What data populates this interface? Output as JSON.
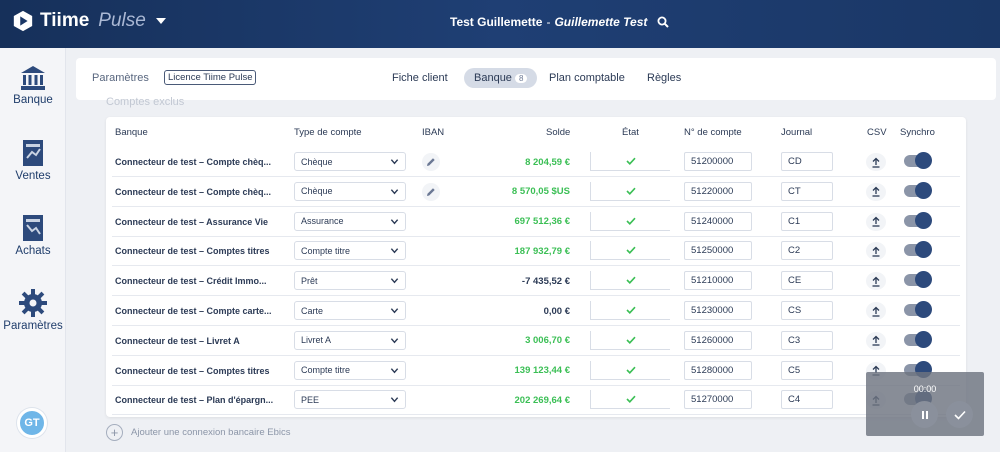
{
  "header": {
    "brand": "Tiime",
    "brand_sub": "Pulse",
    "user_company": "Test Guillemette",
    "user_separator": " - ",
    "user_name": "Guillemette Test"
  },
  "sidebar": {
    "items": [
      {
        "label": "Banque",
        "icon": "bank-icon"
      },
      {
        "label": "Ventes",
        "icon": "sales-document-icon"
      },
      {
        "label": "Achats",
        "icon": "purchases-document-icon"
      },
      {
        "label": "Paramètres",
        "icon": "gear-icon"
      }
    ],
    "avatar_initials": "GT"
  },
  "subnav": {
    "parametres": "Paramètres",
    "licence": "Licence Tiime Pulse",
    "tabs": [
      {
        "label": "Fiche client"
      },
      {
        "label": "Banque",
        "count": "8",
        "active": true
      },
      {
        "label": "Plan comptable"
      },
      {
        "label": "Règles"
      }
    ]
  },
  "faded_label": "Comptes exclus",
  "table": {
    "headers": {
      "banque": "Banque",
      "type": "Type de compte",
      "iban": "IBAN",
      "solde": "Solde",
      "etat": "État",
      "numero": "N° de compte",
      "journal": "Journal",
      "csv": "CSV",
      "synchro": "Synchro"
    },
    "rows": [
      {
        "bank": "Connecteur de test – Compte chèq...",
        "type": "Chèque",
        "iban_edit": true,
        "solde": "8 204,59 €",
        "solde_sign": "pos",
        "account": "51200000",
        "journal": "CD",
        "synchro": true
      },
      {
        "bank": "Connecteur de test – Compte chèq...",
        "type": "Chèque",
        "iban_edit": true,
        "solde": "8 570,05 $US",
        "solde_sign": "pos",
        "account": "51220000",
        "journal": "CT",
        "synchro": true
      },
      {
        "bank": "Connecteur de test – Assurance Vie",
        "type": "Assurance",
        "iban_edit": false,
        "solde": "697 512,36 €",
        "solde_sign": "pos",
        "account": "51240000",
        "journal": "C1",
        "synchro": true
      },
      {
        "bank": "Connecteur de test – Comptes titres",
        "type": "Compte titre",
        "iban_edit": false,
        "solde": "187 932,79 €",
        "solde_sign": "pos",
        "account": "51250000",
        "journal": "C2",
        "synchro": true
      },
      {
        "bank": "Connecteur de test – Crédit Immo...",
        "type": "Prêt",
        "iban_edit": false,
        "solde": "-7 435,52 €",
        "solde_sign": "neg",
        "account": "51210000",
        "journal": "CE",
        "synchro": true
      },
      {
        "bank": "Connecteur de test – Compte carte...",
        "type": "Carte",
        "iban_edit": false,
        "solde": "0,00 €",
        "solde_sign": "neg",
        "account": "51230000",
        "journal": "CS",
        "synchro": true
      },
      {
        "bank": "Connecteur de test – Livret A",
        "type": "Livret A",
        "iban_edit": false,
        "solde": "3 006,70 €",
        "solde_sign": "pos",
        "account": "51260000",
        "journal": "C3",
        "synchro": true
      },
      {
        "bank": "Connecteur de test – Comptes titres",
        "type": "Compte titre",
        "iban_edit": false,
        "solde": "139 123,44 €",
        "solde_sign": "pos",
        "account": "51280000",
        "journal": "C5",
        "synchro": true
      },
      {
        "bank": "Connecteur de test – Plan d'épargn...",
        "type": "PEE",
        "iban_edit": false,
        "solde": "202 269,64 €",
        "solde_sign": "pos",
        "account": "51270000",
        "journal": "C4",
        "synchro": true
      }
    ]
  },
  "add_connection": "Ajouter une connexion bancaire Ebics",
  "recorder": {
    "time": "00:00"
  },
  "colors": {
    "positive": "#3bbf55",
    "accent": "#2d4a7c",
    "header": "#1a3766"
  }
}
